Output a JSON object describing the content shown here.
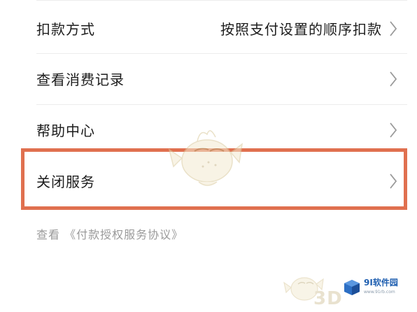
{
  "menu": {
    "items": [
      {
        "label": "扣款方式",
        "value": "按照支付设置的顺序扣款"
      },
      {
        "label": "查看消费记录",
        "value": ""
      },
      {
        "label": "帮助中心",
        "value": ""
      },
      {
        "label": "关闭服务",
        "value": ""
      }
    ]
  },
  "agreement": {
    "prefix": "查看",
    "link": "《付款授权服务协议》"
  },
  "watermark": {
    "brand": "9I软件园",
    "site": "www.91rb.com",
    "mark": "3D"
  },
  "colors": {
    "highlight_border": "#e0704f",
    "text": "#1c1c1c",
    "muted": "#9a9a9a"
  },
  "icons": {
    "chevron": "chevron-right-icon",
    "mascot": "puffer-mascot-watermark"
  }
}
